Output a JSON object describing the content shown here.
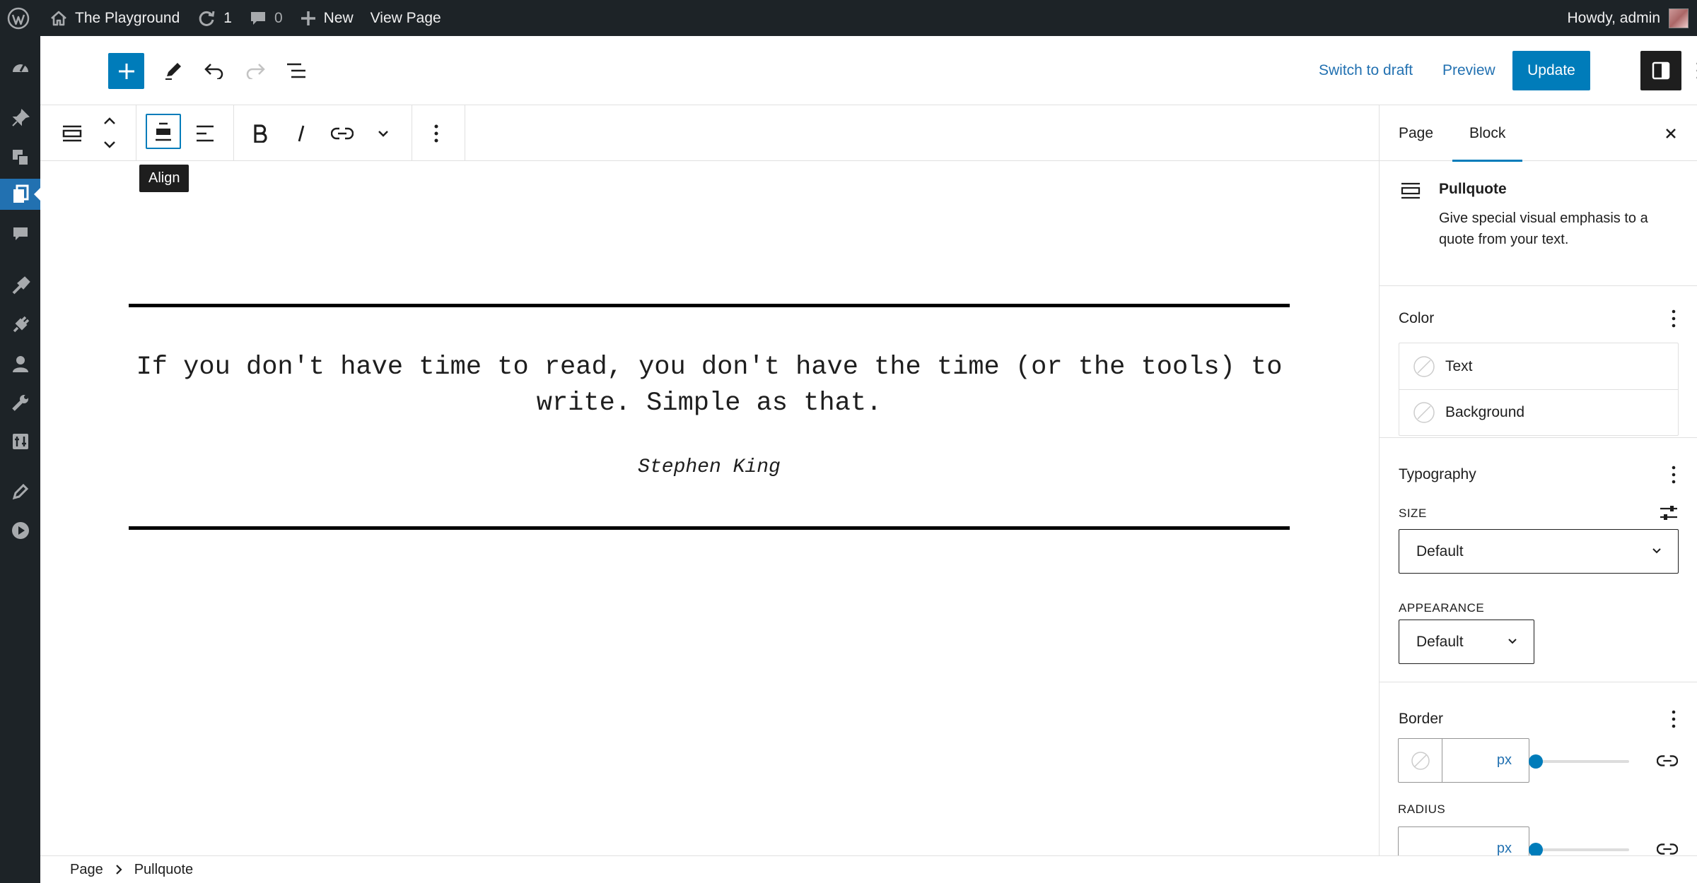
{
  "adminbar": {
    "site_name": "The Playground",
    "updates_count": "1",
    "comments_count": "0",
    "new_label": "New",
    "view_page_label": "View Page",
    "howdy": "Howdy, admin"
  },
  "header": {
    "switch_to_draft": "Switch to draft",
    "preview": "Preview",
    "update": "Update"
  },
  "toolbar": {
    "tooltip": "Align"
  },
  "content": {
    "quote": "If you don't have time to read, you don't have the time (or the tools) to write. Simple as that.",
    "citation": "Stephen King"
  },
  "breadcrumb": {
    "root": "Page",
    "current": "Pullquote"
  },
  "sidebar": {
    "tabs": [
      "Page",
      "Block"
    ],
    "active_tab": "Block",
    "block_card": {
      "title": "Pullquote",
      "description": "Give special visual emphasis to a quote from your text."
    },
    "color": {
      "title": "Color",
      "items": [
        "Text",
        "Background"
      ]
    },
    "typography": {
      "title": "Typography",
      "size_label": "SIZE",
      "size_value": "Default",
      "appearance_label": "APPEARANCE",
      "appearance_value": "Default"
    },
    "border": {
      "title": "Border",
      "unit": "px",
      "radius_label": "RADIUS",
      "radius_unit": "px"
    }
  },
  "colors": {
    "accent": "#007cba",
    "admin_bar": "#1d2327",
    "admin_active": "#2271b1"
  }
}
